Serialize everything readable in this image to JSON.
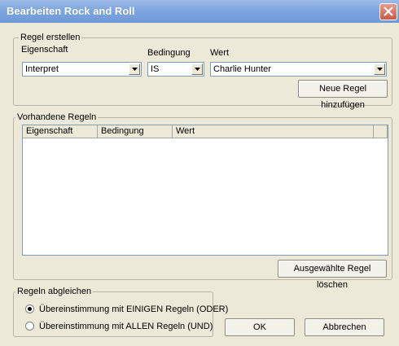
{
  "window": {
    "title": "Bearbeiten Rock and Roll"
  },
  "regel_erstellen": {
    "legend": "Regel erstellen",
    "eigenschaft_label": "Eigenschaft",
    "bedingung_label": "Bedingung",
    "wert_label": "Wert",
    "eigenschaft_value": "Interpret",
    "bedingung_value": "IS",
    "wert_value": "Charlie Hunter",
    "add_button": "Neue Regel hinzufügen"
  },
  "vorhandene_regeln": {
    "legend": "Vorhandene Regeln",
    "columns": [
      "Eigenschaft",
      "Bedingung",
      "Wert"
    ],
    "rows": [],
    "delete_button": "Ausgewählte Regel löschen"
  },
  "regeln_abgleichen": {
    "legend": "Regeln abgleichen",
    "options": [
      {
        "label": "Übereinstimmung mit EINIGEN Regeln (ODER)",
        "checked": true
      },
      {
        "label": "Übereinstimmung mit ALLEN Regeln (UND)",
        "checked": false
      }
    ]
  },
  "buttons": {
    "ok": "OK",
    "cancel": "Abbrechen"
  }
}
